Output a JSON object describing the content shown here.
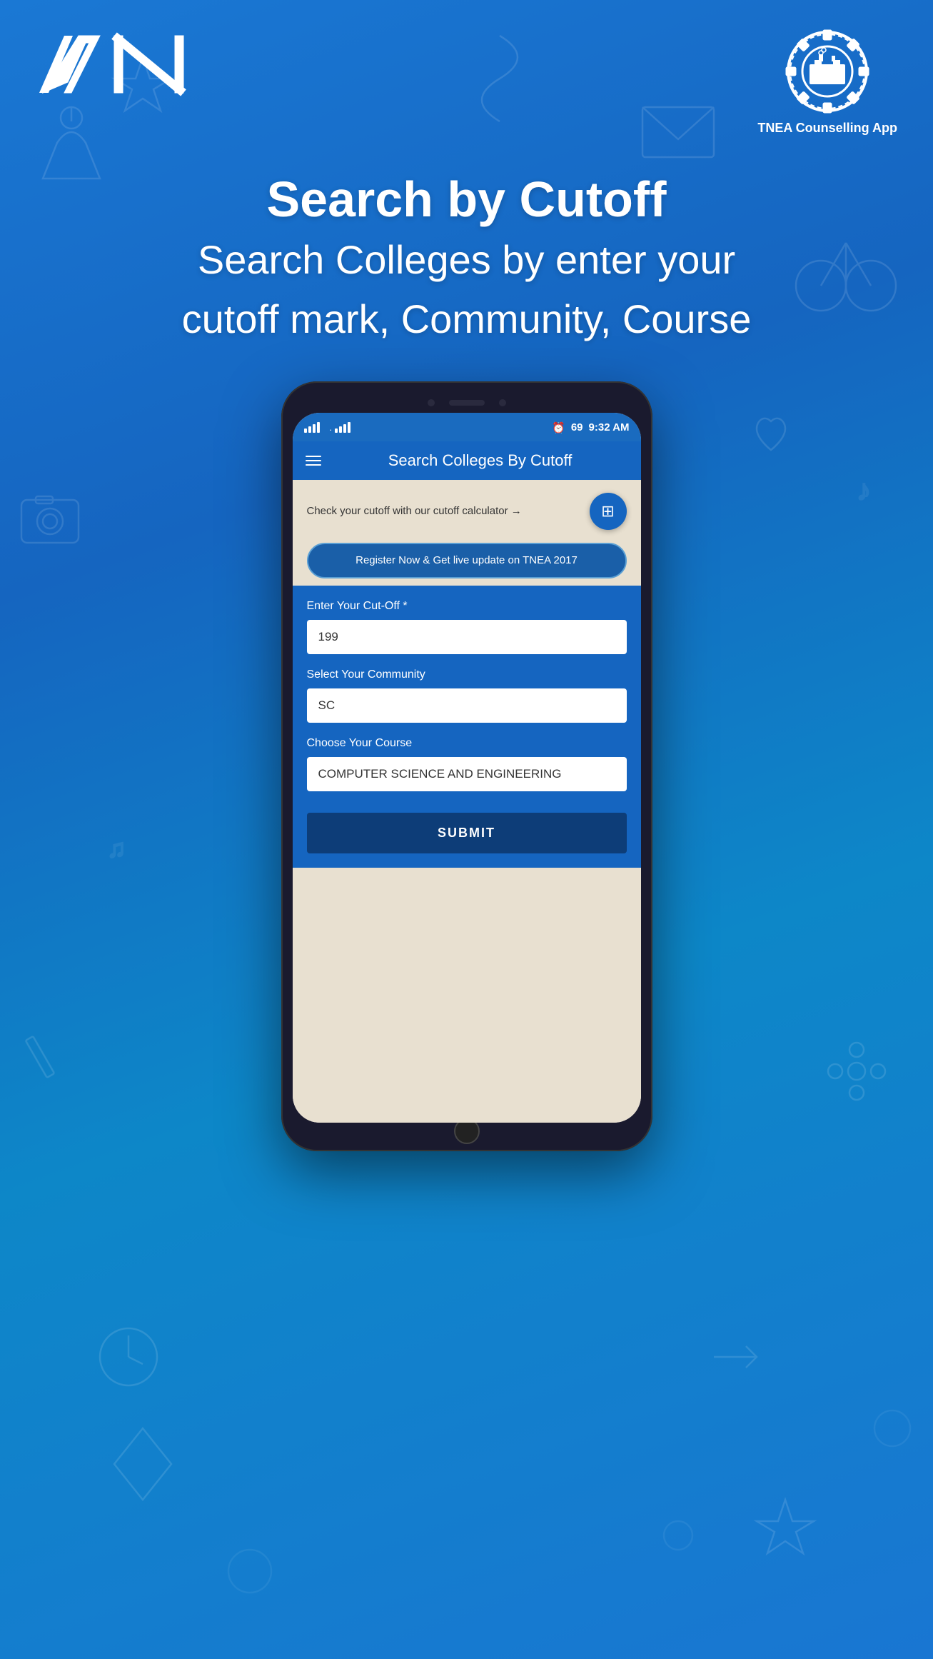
{
  "app": {
    "background_color": "#1565C0"
  },
  "header": {
    "logo_left_alt": "AN Logo",
    "logo_right_alt": "TNEA Counselling App",
    "logo_right_label": "TNEA Counselling App"
  },
  "title_section": {
    "line1": "Search by Cutoff",
    "line2": "Search Colleges by enter your",
    "line3": "cutoff mark, Community, Course"
  },
  "phone": {
    "status_bar": {
      "time": "9:32 AM",
      "battery": "69"
    },
    "app_bar": {
      "title": "Search Colleges By Cutoff"
    },
    "cutoff_calc": {
      "text": "Check your cutoff with our cutoff calculator →",
      "button_icon": "calculator"
    },
    "register_banner": {
      "text": "Register Now & Get live update on TNEA 2017"
    },
    "form": {
      "cutoff_label": "Enter Your Cut-Off *",
      "cutoff_value": "199",
      "community_label": "Select Your Community",
      "community_value": "SC",
      "course_label": "Choose Your Course",
      "course_value": "COMPUTER SCIENCE AND ENGINEERING",
      "submit_label": "SUBMIT"
    }
  }
}
